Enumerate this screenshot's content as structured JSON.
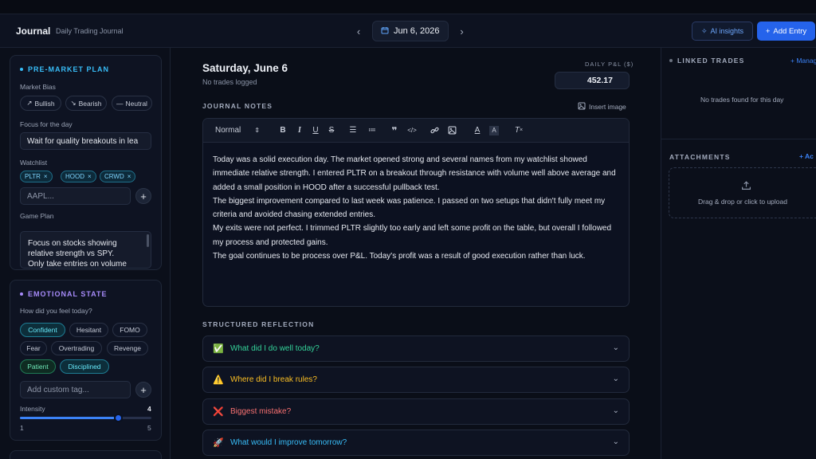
{
  "header": {
    "brand": "Journal",
    "subtitle": "Daily Trading Journal",
    "date": "Jun 6, 2026",
    "ai_label": "AI insights",
    "add_label": "Add Entry"
  },
  "premarket": {
    "title": "PRE-MARKET PLAN",
    "bias_label": "Market Bias",
    "bias_options": [
      "Bullish",
      "Bearish",
      "Neutral"
    ],
    "focus_label": "Focus for the day",
    "focus_value": "Wait for quality breakouts in lea",
    "watchlist_label": "Watchlist",
    "watchlist": [
      "PLTR",
      "HOOD",
      "CRWD"
    ],
    "watchlist_placeholder": "AAPL...",
    "gameplan_label": "Game Plan",
    "gameplan_lines": [
      "Focus on stocks showing",
      "relative strength vs SPY.",
      "Only take entries on volume"
    ]
  },
  "emotional": {
    "title": "EMOTIONAL STATE",
    "question": "How did you feel today?",
    "tags": [
      "Confident",
      "Hesitant",
      "FOMO",
      "Fear",
      "Overtrading",
      "Revenge",
      "Patient",
      "Disciplined"
    ],
    "custom_placeholder": "Add custom tag...",
    "intensity_label": "Intensity",
    "intensity_value": "4",
    "intensity_min": "1",
    "intensity_max": "5",
    "intensity": 4
  },
  "main": {
    "day_title": "Saturday, June 6",
    "day_sub": "No trades logged",
    "pnl_label": "DAILY P&L ($)",
    "pnl_value": "452.17",
    "notes_title": "JOURNAL NOTES",
    "insert_image": "Insert image",
    "format_select": "Normal",
    "paragraphs": [
      "Today was a solid execution day. The market opened strong and several names from my watchlist showed immediate relative strength. I entered PLTR on a breakout through resistance with volume well above average and added a small position in HOOD after a successful pullback test.",
      "The biggest improvement compared to last week was patience. I passed on two setups that didn't fully meet my criteria and avoided chasing extended entries.",
      "My exits were not perfect. I trimmed PLTR slightly too early and left some profit on the table, but overall I followed my process and protected gains.",
      "The goal continues to be process over P&L. Today's profit was a result of good execution rather than luck."
    ],
    "reflection_title": "STRUCTURED REFLECTION",
    "reflections": [
      {
        "emoji": "✅",
        "label": "What did I do well today?",
        "color": "#34d399"
      },
      {
        "emoji": "⚠️",
        "label": "Where did I break rules?",
        "color": "#fbbf24"
      },
      {
        "emoji": "❌",
        "label": "Biggest mistake?",
        "color": "#f87171"
      },
      {
        "emoji": "🚀",
        "label": "What would I improve tomorrow?",
        "color": "#38bdf8"
      }
    ]
  },
  "right": {
    "linked_title": "LINKED TRADES",
    "manage_label": "+ Manag",
    "empty_text": "No trades found for this day",
    "attachments_title": "ATTACHMENTS",
    "add_label": "+ Ac",
    "upload_text": "Drag & drop or click to upload"
  }
}
